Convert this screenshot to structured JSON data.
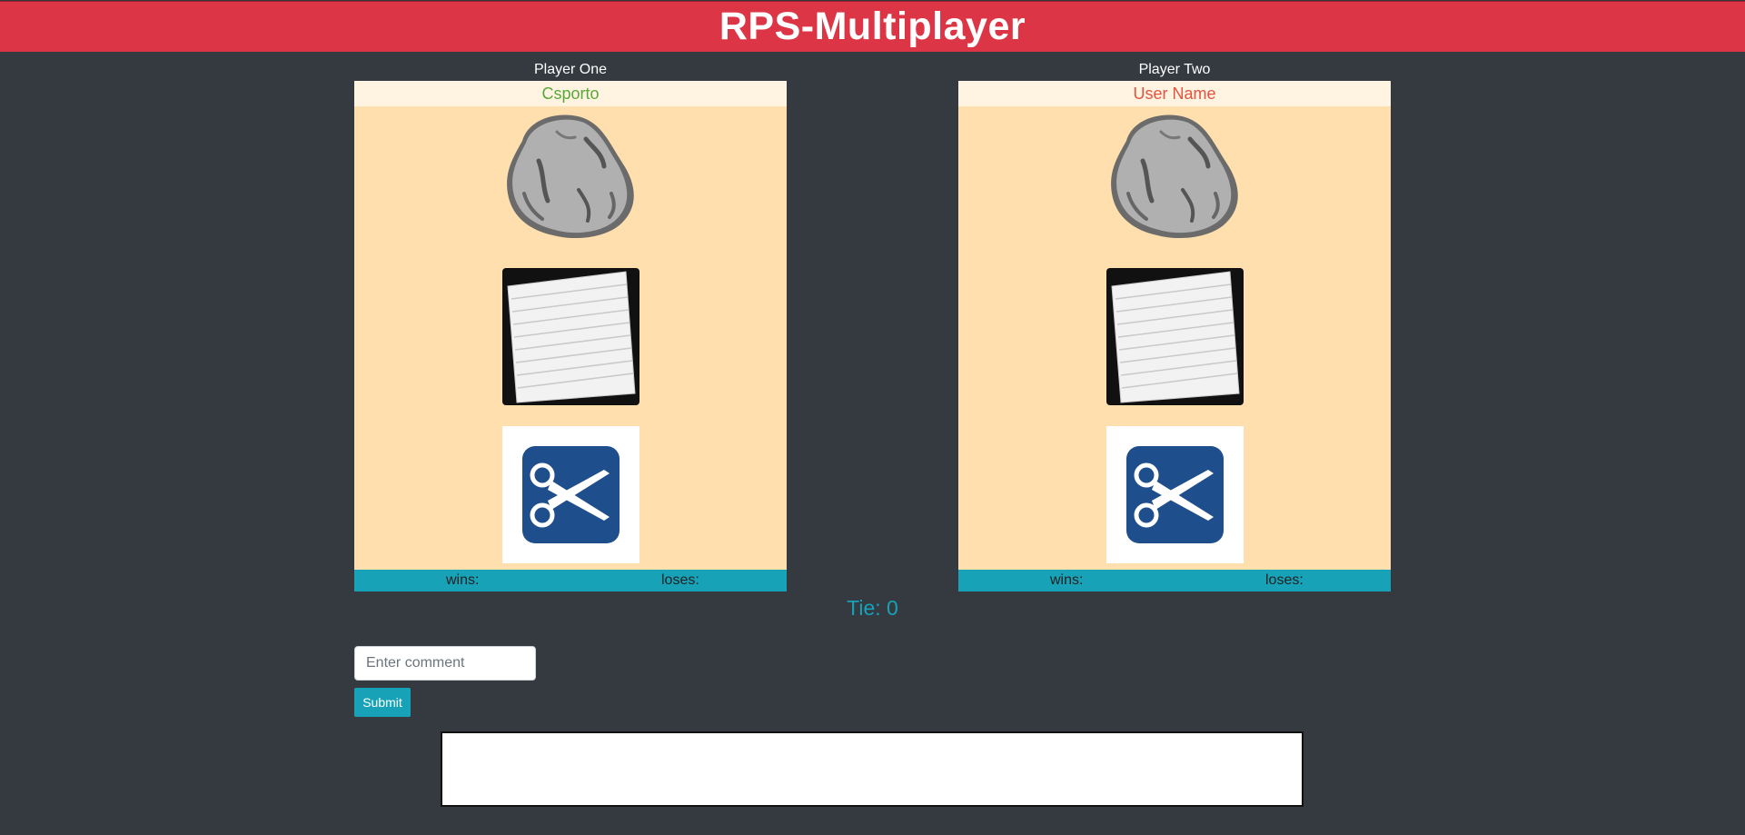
{
  "header": {
    "title": "RPS-Multiplayer"
  },
  "players": [
    {
      "heading": "Player One",
      "name": "Csporto",
      "name_color": "#5aa83a",
      "wins_label": "wins:",
      "loses_label": "loses:"
    },
    {
      "heading": "Player Two",
      "name": "User Name",
      "name_color": "#e5533f",
      "wins_label": "wins:",
      "loses_label": "loses:"
    }
  ],
  "choices": [
    "rock-icon",
    "paper-icon",
    "scissors-icon"
  ],
  "tie": {
    "text": "Tie: 0"
  },
  "comment": {
    "placeholder": "Enter comment",
    "value": ""
  },
  "submit": {
    "label": "Submit"
  },
  "colors": {
    "header": "#dc3545",
    "background": "#343a40",
    "panel": "#ffdfad",
    "name_bar": "#fff3e2",
    "accent": "#17a2b8",
    "scissors_tile": "#1f4e8c"
  }
}
